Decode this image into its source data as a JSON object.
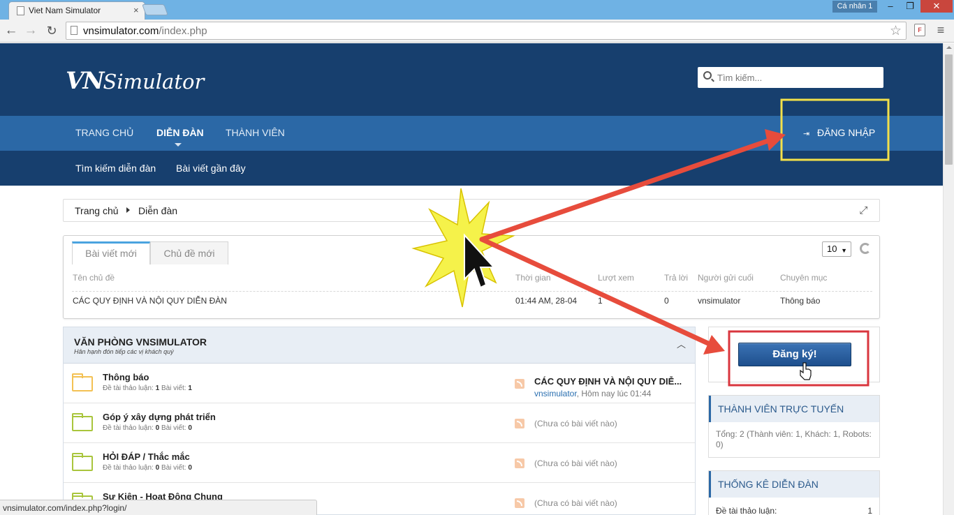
{
  "browser": {
    "tab_title": "Viet Nam Simulator",
    "tab_close": "×",
    "profile_label": "Cá nhân 1",
    "url_host": "vnsimulator.com",
    "url_path": "/index.php",
    "minimize": "‒",
    "maximize": "❐",
    "close": "✕",
    "back_icon": "←",
    "forward_icon": "→",
    "reload_icon": "↻",
    "star_icon": "☆",
    "menu_icon": "≡",
    "status_url": "vnsimulator.com/index.php?login/"
  },
  "header": {
    "logo_vn": "VN",
    "logo_sim": "Simulator",
    "search_placeholder": "Tìm kiếm..."
  },
  "nav": {
    "home": "TRANG CHỦ",
    "forum": "DIỄN ĐÀN",
    "members": "THÀNH VIÊN",
    "login": "ĐĂNG NHẬP",
    "login_icon": "⇥"
  },
  "subnav": {
    "search_forums": "Tìm kiếm diễn đàn",
    "recent_posts": "Bài viết gần đây"
  },
  "breadcrumb": {
    "home": "Trang chủ",
    "forum": "Diễn đàn",
    "fullscreen_icon": "⤢"
  },
  "new_posts": {
    "tabs": [
      "Bài viết mới",
      "Chủ đề mới"
    ],
    "per_page": "10",
    "caret": "▼",
    "columns": [
      "Tên chủ đề",
      "Thời gian",
      "Lượt xem",
      "Trả lời",
      "Người gửi cuối",
      "Chuyên mục"
    ],
    "rows": [
      {
        "title": "CÁC QUY ĐỊNH VÀ NỘI QUY DIỄN ĐÀN",
        "time": "01:44 AM, 28-04",
        "views": "1",
        "replies": "0",
        "last_poster": "vnsimulator",
        "category": "Thông báo"
      }
    ]
  },
  "category": {
    "title": "VĂN PHÒNG VNSIMULATOR",
    "subtitle": "Hân hạnh đón tiếp các vị khách quý",
    "collapse_icon": "︿",
    "stats_labels": {
      "threads": "Đề tài thảo luận:",
      "posts": "Bài viết:"
    },
    "forums": [
      {
        "name": "Thông báo",
        "threads": "1",
        "posts": "1",
        "last_title": "CÁC QUY ĐỊNH VÀ NỘI QUY DIỄ...",
        "last_user": "vnsimulator",
        "last_time": ", Hôm nay lúc 01:44",
        "empty": ""
      },
      {
        "name": "Góp ý xây dựng phát triển",
        "threads": "0",
        "posts": "0",
        "last_title": "",
        "last_user": "",
        "last_time": "",
        "empty": "(Chưa có bài viết nào)"
      },
      {
        "name": "HỎI ĐÁP / Thắc mắc",
        "threads": "0",
        "posts": "0",
        "last_title": "",
        "last_user": "",
        "last_time": "",
        "empty": "(Chưa có bài viết nào)"
      },
      {
        "name": "Sự Kiện - Hoạt Động Chung",
        "threads": "",
        "posts": "",
        "last_title": "",
        "last_user": "",
        "last_time": "",
        "empty": "(Chưa có bài viết nào)"
      }
    ]
  },
  "sidebar": {
    "register_button": "Đăng ký!",
    "online_title": "THÀNH VIÊN TRỰC TUYẾN",
    "online_text": "Tổng: 2 (Thành viên: 1, Khách: 1, Robots: 0)",
    "stats_title": "THỐNG KÊ DIỄN ĐÀN",
    "stats_threads_label": "Đề tài thảo luận:",
    "stats_threads_value": "1"
  },
  "colors": {
    "header_dark": "#173f6e",
    "nav_blue": "#2b68a6",
    "highlight_yellow": "#f3e04a",
    "highlight_red": "#d9363e",
    "arrow_red": "#e74c3c"
  }
}
